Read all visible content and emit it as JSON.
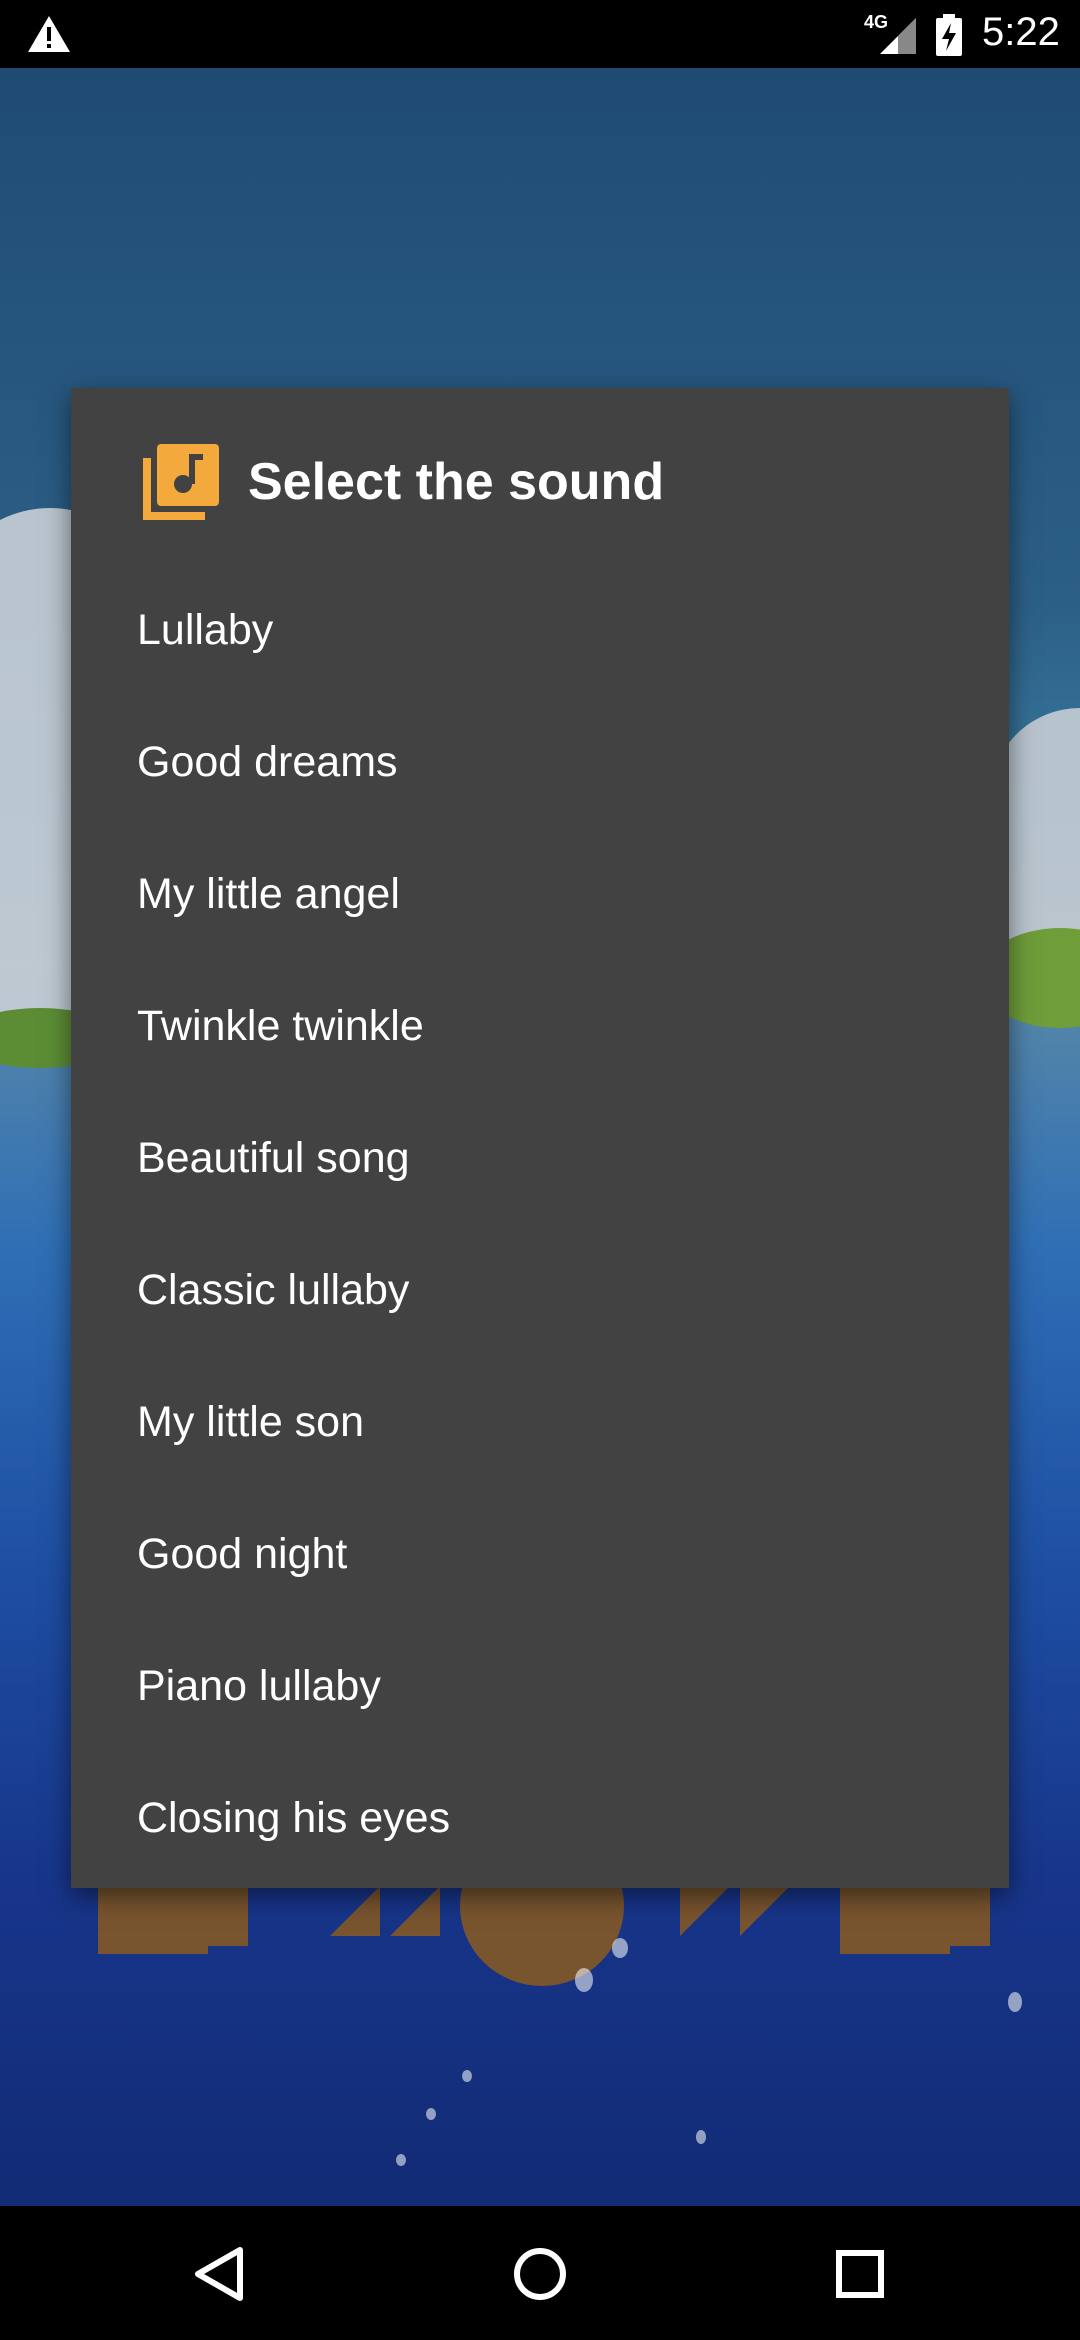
{
  "status_bar": {
    "network": "4G",
    "time": "5:22",
    "icons": [
      "warning-icon",
      "signal-icon",
      "battery-charging-icon"
    ]
  },
  "dialog": {
    "title": "Select the sound",
    "icon": "music-library-icon",
    "icon_color": "#F3A93B",
    "items": [
      {
        "label": "Lullaby"
      },
      {
        "label": "Good dreams"
      },
      {
        "label": "My little angel"
      },
      {
        "label": "Twinkle twinkle"
      },
      {
        "label": "Beautiful song"
      },
      {
        "label": "Classic lullaby"
      },
      {
        "label": "My little son"
      },
      {
        "label": "Good night"
      },
      {
        "label": "Piano lullaby"
      },
      {
        "label": "Closing his eyes"
      }
    ]
  },
  "nav_bar": {
    "icons": [
      "back-icon",
      "home-icon",
      "recents-icon"
    ]
  },
  "colors": {
    "dialog_background": "#424242",
    "accent": "#F3A93B",
    "text": "#FFFFFF"
  }
}
